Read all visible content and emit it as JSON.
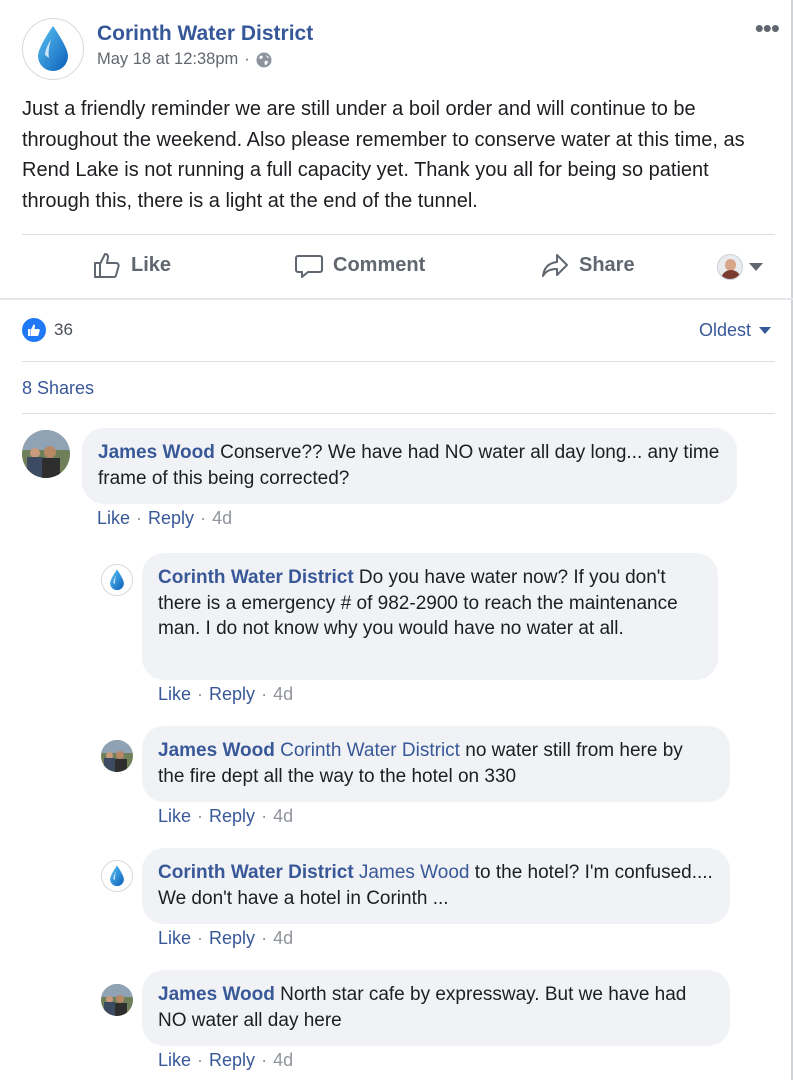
{
  "post": {
    "page_name": "Corinth Water District",
    "timestamp": "May 18 at 12:38pm",
    "dot": "·",
    "more": "•••",
    "text": "Just a friendly reminder we are still under a boil order and will continue to be throughout the weekend. Also please remember to conserve water at this time, as Rend Lake is not running a full capacity yet. Thank you all for being so patient through this, there is a light at the end of the tunnel."
  },
  "actions": {
    "like": "Like",
    "comment": "Comment",
    "share": "Share"
  },
  "reactions": {
    "count": "36",
    "sort": "Oldest",
    "shares": "8 Shares"
  },
  "comments": [
    {
      "author": "James Wood",
      "text": " Conserve?? We have had NO water all day long... any time frame of this being corrected?",
      "like": "Like",
      "reply": "Reply",
      "time": "4d"
    },
    {
      "author": "Corinth Water District",
      "text": " Do you have water now? If you don't there is a emergency # of 982-2900 to reach the maintenance man. I do not know why you would have no water at all.",
      "like": "Like",
      "reply": "Reply",
      "time": "4d"
    },
    {
      "author": "James Wood",
      "mention": " Corinth Water District",
      "text": " no water still from here by the fire dept all the way to the hotel on 330",
      "like": "Like",
      "reply": "Reply",
      "time": "4d"
    },
    {
      "author": "Corinth Water District",
      "mention": " James Wood",
      "text": " to the hotel? I'm confused.... We don't have a hotel in Corinth ...",
      "like": "Like",
      "reply": "Reply",
      "time": "4d"
    },
    {
      "author": "James Wood",
      "text": " North star cafe by expressway. But we have had NO water all day here",
      "like": "Like",
      "reply": "Reply",
      "time": "4d"
    }
  ],
  "sep": "·",
  "colors": {
    "link_blue": "#385898",
    "bubble_bg": "#f0f2f5",
    "like_blue": "#2078f4",
    "drop_blue": "#1a8fe3"
  }
}
